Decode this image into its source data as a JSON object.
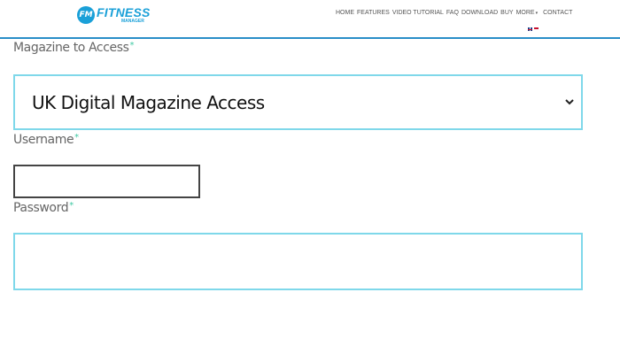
{
  "brand": {
    "badge": "FM",
    "name": "FITNESS",
    "sub": "MANAGER",
    "color": "#1aa0d8"
  },
  "nav": {
    "items": [
      "HOME",
      "FEATURES",
      "VIDEO TUTORIAL",
      "FAQ",
      "DOWNLOAD",
      "BUY",
      "MORE"
    ],
    "more_indicator": "▾",
    "contact": "CONTACT"
  },
  "form": {
    "magazine_label": "Magazine to Access",
    "magazine_value": "UK Digital Magazine Access",
    "username_label": "Username",
    "username_value": "",
    "password_label": "Password",
    "password_value": "",
    "required_marker": "*"
  },
  "colors": {
    "accent_border": "#7fd8ea",
    "header_rule": "#2a8ec8",
    "required": "#3fc9a3"
  },
  "icons": {
    "select": "chevron-down-icon",
    "flags": [
      "uk-flag-icon",
      "language-flag-icon"
    ]
  }
}
